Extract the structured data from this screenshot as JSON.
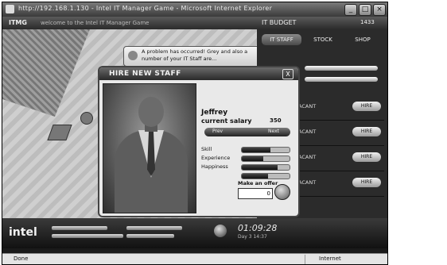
{
  "window": {
    "title": "http://192.168.1.130 - Intel IT Manager Game - Microsoft Internet Explorer"
  },
  "game_bar": {
    "brand": "ITMG",
    "subtitle": "welcome to the Intel IT Manager Game",
    "budget_label": "IT BUDGET",
    "budget_value": "1433"
  },
  "notification": {
    "text": "A problem has occurred! Grey and also a number of your IT Staff are..."
  },
  "panel": {
    "tabs": [
      "IT STAFF",
      "STOCK",
      "SHOP"
    ],
    "rows": [
      {
        "label": "VACANT",
        "button": "HIRE"
      },
      {
        "label": "VACANT",
        "button": "HIRE"
      },
      {
        "label": "VACANT",
        "button": "HIRE"
      },
      {
        "label": "VACANT",
        "button": "HIRE"
      }
    ]
  },
  "dialog": {
    "title": "HIRE NEW STAFF",
    "close": "X",
    "name": "Jeffrey",
    "salary_label": "current salary",
    "salary_value": "350",
    "prev_label": "Prev",
    "next_label": "Next",
    "stats": [
      {
        "label": "Skill",
        "value": 0.6
      },
      {
        "label": "Experience",
        "value": 0.45
      },
      {
        "label": "Happiness",
        "value": 0.75
      },
      {
        "label": "",
        "value": 0.55
      }
    ],
    "offer_label": "Make an offer",
    "offer_value": "0"
  },
  "bottom_bar": {
    "logo": "intel",
    "clock": "01:09:28",
    "version": "Day 3 14:37"
  },
  "status_bar": {
    "left": "Done",
    "right": "Internet"
  }
}
